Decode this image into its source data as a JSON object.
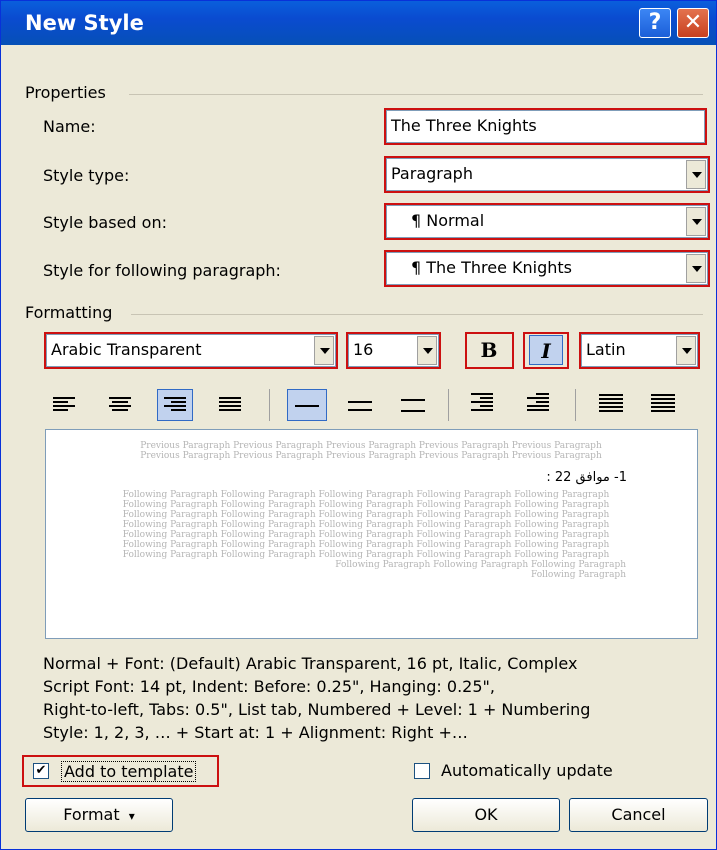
{
  "window": {
    "title": "New Style",
    "help_glyph": "?",
    "close_glyph": "✕"
  },
  "properties": {
    "group_label": "Properties",
    "name_label": "Name:",
    "name_value": "The Three Knights",
    "style_type_label": "Style type:",
    "style_type_value": "Paragraph",
    "based_on_label": "Style based on:",
    "based_on_value": "¶ Normal",
    "following_label": "Style for following paragraph:",
    "following_value": "¶ The Three Knights"
  },
  "formatting": {
    "group_label": "Formatting",
    "font": "Arabic Transparent",
    "size": "16",
    "bold": "B",
    "italic": "I",
    "script": "Latin"
  },
  "preview": {
    "previous_lines": [
      "Previous Paragraph Previous Paragraph Previous Paragraph Previous Paragraph Previous Paragraph",
      "Previous Paragraph Previous Paragraph Previous Paragraph Previous Paragraph Previous Paragraph"
    ],
    "sample": "1- موافق 22 :",
    "following_lines": [
      "Following Paragraph Following Paragraph Following Paragraph Following Paragraph Following Paragraph",
      "Following Paragraph Following Paragraph Following Paragraph Following Paragraph Following Paragraph",
      "Following Paragraph Following Paragraph Following Paragraph Following Paragraph Following Paragraph",
      "Following Paragraph Following Paragraph Following Paragraph Following Paragraph Following Paragraph",
      "Following Paragraph Following Paragraph Following Paragraph Following Paragraph Following Paragraph",
      "Following Paragraph Following Paragraph Following Paragraph Following Paragraph Following Paragraph",
      "Following Paragraph Following Paragraph Following Paragraph Following Paragraph Following Paragraph"
    ],
    "following_last": "Following Paragraph Following Paragraph Following Paragraph Following Paragraph"
  },
  "description": {
    "line1": "Normal + Font: (Default) Arabic Transparent, 16 pt, Italic, Complex",
    "line2": "Script Font: 14 pt, Indent: Before:  0.25\", Hanging:  0.25\",",
    "line3": "Right-to-left, Tabs:  0.5\", List tab, Numbered + Level: 1 + Numbering",
    "line4": "Style: 1, 2, 3, … + Start at: 1 + Alignment: Right +…"
  },
  "options": {
    "add_to_template": "Add to template",
    "add_to_template_checked": true,
    "add_mark": "✔",
    "auto_update": "Automatically update",
    "auto_update_checked": false
  },
  "buttons": {
    "format": "Format",
    "format_arrow": "▾",
    "ok": "OK",
    "cancel": "Cancel"
  },
  "colors": {
    "titlebar": "#0a4bd0",
    "highlight": "#cc1010",
    "dialog": "#ece9d8"
  }
}
